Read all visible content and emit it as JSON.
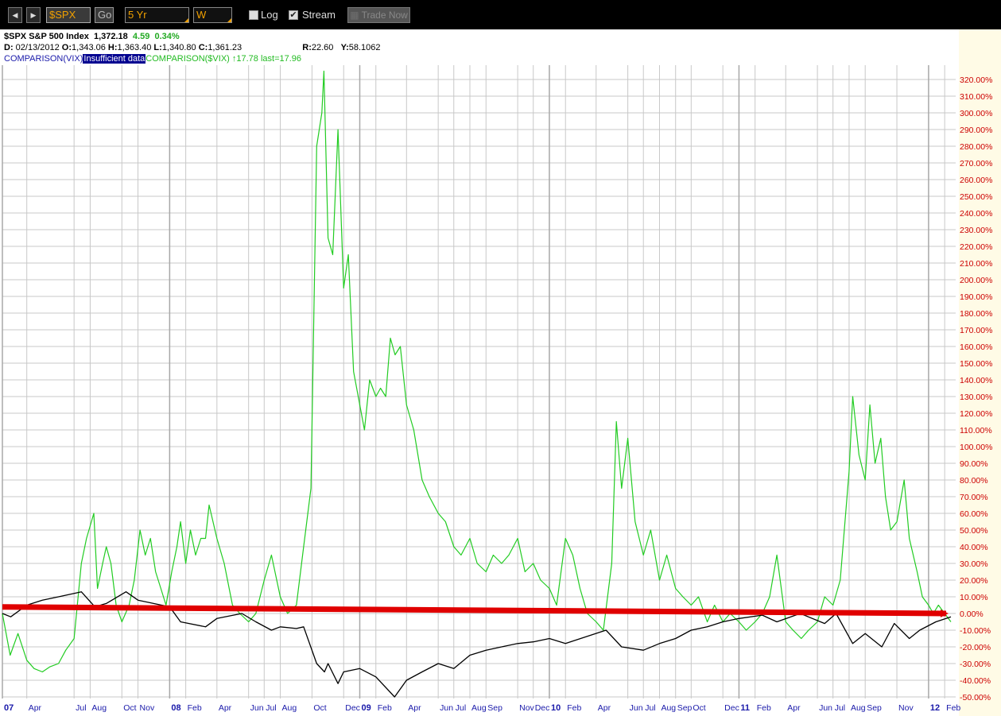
{
  "toolbar": {
    "back_label": "◀",
    "forward_label": "▶",
    "symbol": "$SPX",
    "go_label": "Go",
    "range": "5 Yr",
    "period": "W",
    "log_label": "Log",
    "log_checked": false,
    "stream_label": "Stream",
    "stream_checked": true,
    "trade_label": "Trade Now"
  },
  "header": {
    "symbol": "$SPX",
    "name": "S&P 500 Index",
    "last": "1,372.18",
    "change": "4.59",
    "change_pct": "0.34%",
    "date_label": "D:",
    "date": "02/13/2012",
    "open_label": "O:",
    "open": "1,343.06",
    "high_label": "H:",
    "high": "1,363.40",
    "low_label": "L:",
    "low": "1,340.80",
    "close_label": "C:",
    "close": "1,361.23",
    "r_label": "R:",
    "r": "22.60",
    "y_label": "Y:",
    "y": "58.1062",
    "comparison1": "COMPARISON(VIX)",
    "comparison1_status": "Insufficient data",
    "comparison2": "COMPARISON($VIX) ↑17.78 last=17.96"
  },
  "colors": {
    "vix_line": "#22cc22",
    "spx_line": "#000000",
    "arrow": "#e00000",
    "y_tick_label": "#cc0000",
    "x_month_label": "#1a1aaa",
    "grid": "#c8c8c8"
  },
  "chart_data": {
    "type": "line",
    "ylim": [
      -50,
      330
    ],
    "y_ticks": [
      320,
      310,
      300,
      290,
      280,
      270,
      260,
      250,
      240,
      230,
      220,
      210,
      200,
      190,
      180,
      170,
      160,
      150,
      140,
      130,
      120,
      110,
      100,
      90,
      80,
      70,
      60,
      50,
      40,
      30,
      20,
      10,
      0,
      -10,
      -20,
      -30,
      -40,
      -50
    ],
    "y_tick_labels": [
      "320.00%",
      "310.00%",
      "300.00%",
      "290.00%",
      "280.00%",
      "270.00%",
      "260.00%",
      "250.00%",
      "240.00%",
      "230.00%",
      "220.00%",
      "210.00%",
      "200.00%",
      "190.00%",
      "180.00%",
      "170.00%",
      "160.00%",
      "150.00%",
      "140.00%",
      "130.00%",
      "120.00%",
      "110.00%",
      "100.00%",
      "90.00%",
      "80.00%",
      "70.00%",
      "60.00%",
      "50.00%",
      "40.00%",
      "30.00%",
      "20.00%",
      "10.00%",
      "0.00%",
      "-10.00%",
      "-20.00%",
      "-30.00%",
      "-40.00%",
      "-50.00%"
    ],
    "x_ticks": [
      {
        "date": "2007-02-13",
        "label": "07",
        "major": true
      },
      {
        "date": "2007-04-01",
        "label": "Apr"
      },
      {
        "date": "2007-07-01",
        "label": "Jul"
      },
      {
        "date": "2007-08-01",
        "label": "Aug"
      },
      {
        "date": "2007-10-01",
        "label": "Oct"
      },
      {
        "date": "2007-11-01",
        "label": "Nov"
      },
      {
        "date": "2008-01-01",
        "label": "08",
        "major": true
      },
      {
        "date": "2008-02-01",
        "label": "Feb"
      },
      {
        "date": "2008-04-01",
        "label": "Apr"
      },
      {
        "date": "2008-06-01",
        "label": "Jun"
      },
      {
        "date": "2008-07-01",
        "label": "Jul"
      },
      {
        "date": "2008-08-01",
        "label": "Aug"
      },
      {
        "date": "2008-10-01",
        "label": "Oct"
      },
      {
        "date": "2008-12-01",
        "label": "Dec"
      },
      {
        "date": "2009-01-01",
        "label": "09",
        "major": true
      },
      {
        "date": "2009-02-01",
        "label": "Feb"
      },
      {
        "date": "2009-04-01",
        "label": "Apr"
      },
      {
        "date": "2009-06-01",
        "label": "Jun"
      },
      {
        "date": "2009-07-01",
        "label": "Jul"
      },
      {
        "date": "2009-08-01",
        "label": "Aug"
      },
      {
        "date": "2009-09-01",
        "label": "Sep"
      },
      {
        "date": "2009-11-01",
        "label": "Nov"
      },
      {
        "date": "2009-12-01",
        "label": "Dec"
      },
      {
        "date": "2010-01-01",
        "label": "10",
        "major": true
      },
      {
        "date": "2010-02-01",
        "label": "Feb"
      },
      {
        "date": "2010-04-01",
        "label": "Apr"
      },
      {
        "date": "2010-06-01",
        "label": "Jun"
      },
      {
        "date": "2010-07-01",
        "label": "Jul"
      },
      {
        "date": "2010-08-01",
        "label": "Aug"
      },
      {
        "date": "2010-09-01",
        "label": "Sep"
      },
      {
        "date": "2010-10-01",
        "label": "Oct"
      },
      {
        "date": "2010-12-01",
        "label": "Dec"
      },
      {
        "date": "2011-01-01",
        "label": "11",
        "major": true
      },
      {
        "date": "2011-02-01",
        "label": "Feb"
      },
      {
        "date": "2011-04-01",
        "label": "Apr"
      },
      {
        "date": "2011-06-01",
        "label": "Jun"
      },
      {
        "date": "2011-07-01",
        "label": "Jul"
      },
      {
        "date": "2011-08-01",
        "label": "Aug"
      },
      {
        "date": "2011-09-01",
        "label": "Sep"
      },
      {
        "date": "2011-11-01",
        "label": "Nov"
      },
      {
        "date": "2012-01-01",
        "label": "12",
        "major": true
      },
      {
        "date": "2012-02-01",
        "label": "Feb"
      }
    ],
    "series": [
      {
        "name": "COMPARISON($VIX)",
        "points": [
          [
            "2007-02-13",
            0
          ],
          [
            "2007-02-28",
            -25
          ],
          [
            "2007-03-15",
            -12
          ],
          [
            "2007-04-01",
            -28
          ],
          [
            "2007-04-15",
            -33
          ],
          [
            "2007-05-01",
            -35
          ],
          [
            "2007-05-15",
            -32
          ],
          [
            "2007-06-01",
            -30
          ],
          [
            "2007-06-15",
            -22
          ],
          [
            "2007-07-01",
            -15
          ],
          [
            "2007-07-15",
            30
          ],
          [
            "2007-07-25",
            45
          ],
          [
            "2007-08-08",
            60
          ],
          [
            "2007-08-15",
            15
          ],
          [
            "2007-08-25",
            30
          ],
          [
            "2007-09-01",
            40
          ],
          [
            "2007-09-10",
            30
          ],
          [
            "2007-09-20",
            5
          ],
          [
            "2007-10-01",
            -5
          ],
          [
            "2007-10-15",
            5
          ],
          [
            "2007-10-25",
            20
          ],
          [
            "2007-11-05",
            50
          ],
          [
            "2007-11-15",
            35
          ],
          [
            "2007-11-25",
            45
          ],
          [
            "2007-12-05",
            25
          ],
          [
            "2007-12-15",
            15
          ],
          [
            "2007-12-25",
            5
          ],
          [
            "2008-01-05",
            25
          ],
          [
            "2008-01-15",
            40
          ],
          [
            "2008-01-22",
            55
          ],
          [
            "2008-02-01",
            30
          ],
          [
            "2008-02-10",
            50
          ],
          [
            "2008-02-20",
            35
          ],
          [
            "2008-03-01",
            45
          ],
          [
            "2008-03-10",
            45
          ],
          [
            "2008-03-17",
            65
          ],
          [
            "2008-04-01",
            45
          ],
          [
            "2008-04-15",
            30
          ],
          [
            "2008-05-01",
            5
          ],
          [
            "2008-05-15",
            0
          ],
          [
            "2008-06-01",
            -5
          ],
          [
            "2008-06-15",
            0
          ],
          [
            "2008-07-01",
            20
          ],
          [
            "2008-07-15",
            35
          ],
          [
            "2008-08-01",
            10
          ],
          [
            "2008-08-15",
            0
          ],
          [
            "2008-09-01",
            5
          ],
          [
            "2008-09-15",
            40
          ],
          [
            "2008-09-29",
            75
          ],
          [
            "2008-10-10",
            280
          ],
          [
            "2008-10-20",
            300
          ],
          [
            "2008-10-24",
            325
          ],
          [
            "2008-11-01",
            225
          ],
          [
            "2008-11-10",
            215
          ],
          [
            "2008-11-20",
            290
          ],
          [
            "2008-12-01",
            195
          ],
          [
            "2008-12-10",
            215
          ],
          [
            "2008-12-20",
            145
          ],
          [
            "2009-01-01",
            125
          ],
          [
            "2009-01-10",
            110
          ],
          [
            "2009-01-20",
            140
          ],
          [
            "2009-02-01",
            130
          ],
          [
            "2009-02-10",
            135
          ],
          [
            "2009-02-20",
            130
          ],
          [
            "2009-03-01",
            165
          ],
          [
            "2009-03-10",
            155
          ],
          [
            "2009-03-20",
            160
          ],
          [
            "2009-04-01",
            125
          ],
          [
            "2009-04-15",
            110
          ],
          [
            "2009-05-01",
            80
          ],
          [
            "2009-05-15",
            70
          ],
          [
            "2009-06-01",
            60
          ],
          [
            "2009-06-15",
            55
          ],
          [
            "2009-07-01",
            40
          ],
          [
            "2009-07-15",
            35
          ],
          [
            "2009-08-01",
            45
          ],
          [
            "2009-08-15",
            30
          ],
          [
            "2009-09-01",
            25
          ],
          [
            "2009-09-15",
            35
          ],
          [
            "2009-10-01",
            30
          ],
          [
            "2009-10-15",
            35
          ],
          [
            "2009-11-01",
            45
          ],
          [
            "2009-11-15",
            25
          ],
          [
            "2009-12-01",
            30
          ],
          [
            "2009-12-15",
            20
          ],
          [
            "2010-01-01",
            15
          ],
          [
            "2010-01-15",
            5
          ],
          [
            "2010-02-01",
            45
          ],
          [
            "2010-02-15",
            35
          ],
          [
            "2010-03-01",
            15
          ],
          [
            "2010-03-15",
            0
          ],
          [
            "2010-04-01",
            -5
          ],
          [
            "2010-04-15",
            -10
          ],
          [
            "2010-05-01",
            30
          ],
          [
            "2010-05-10",
            115
          ],
          [
            "2010-05-20",
            75
          ],
          [
            "2010-06-01",
            105
          ],
          [
            "2010-06-15",
            55
          ],
          [
            "2010-07-01",
            35
          ],
          [
            "2010-07-15",
            50
          ],
          [
            "2010-08-01",
            20
          ],
          [
            "2010-08-15",
            35
          ],
          [
            "2010-09-01",
            15
          ],
          [
            "2010-09-15",
            10
          ],
          [
            "2010-10-01",
            5
          ],
          [
            "2010-10-15",
            10
          ],
          [
            "2010-11-01",
            -5
          ],
          [
            "2010-11-15",
            5
          ],
          [
            "2010-12-01",
            -5
          ],
          [
            "2010-12-15",
            0
          ],
          [
            "2011-01-01",
            -5
          ],
          [
            "2011-01-15",
            -10
          ],
          [
            "2011-02-01",
            -5
          ],
          [
            "2011-02-15",
            0
          ],
          [
            "2011-03-01",
            10
          ],
          [
            "2011-03-15",
            35
          ],
          [
            "2011-04-01",
            -5
          ],
          [
            "2011-04-15",
            -10
          ],
          [
            "2011-05-01",
            -15
          ],
          [
            "2011-05-15",
            -10
          ],
          [
            "2011-06-01",
            -5
          ],
          [
            "2011-06-15",
            10
          ],
          [
            "2011-07-01",
            5
          ],
          [
            "2011-07-15",
            20
          ],
          [
            "2011-08-01",
            85
          ],
          [
            "2011-08-08",
            130
          ],
          [
            "2011-08-20",
            95
          ],
          [
            "2011-09-01",
            80
          ],
          [
            "2011-09-10",
            125
          ],
          [
            "2011-09-20",
            90
          ],
          [
            "2011-10-01",
            105
          ],
          [
            "2011-10-10",
            70
          ],
          [
            "2011-10-20",
            50
          ],
          [
            "2011-11-01",
            55
          ],
          [
            "2011-11-15",
            80
          ],
          [
            "2011-11-25",
            45
          ],
          [
            "2011-12-10",
            25
          ],
          [
            "2011-12-20",
            10
          ],
          [
            "2012-01-01",
            5
          ],
          [
            "2012-01-10",
            0
          ],
          [
            "2012-01-20",
            5
          ],
          [
            "2012-02-01",
            0
          ],
          [
            "2012-02-13",
            -5
          ]
        ]
      },
      {
        "name": "$SPX",
        "points": [
          [
            "2007-02-13",
            0
          ],
          [
            "2007-03-01",
            -2
          ],
          [
            "2007-04-01",
            5
          ],
          [
            "2007-05-01",
            8
          ],
          [
            "2007-06-01",
            10
          ],
          [
            "2007-07-01",
            12
          ],
          [
            "2007-07-15",
            13
          ],
          [
            "2007-08-10",
            4
          ],
          [
            "2007-09-01",
            6
          ],
          [
            "2007-10-09",
            13
          ],
          [
            "2007-11-01",
            8
          ],
          [
            "2007-12-01",
            6
          ],
          [
            "2008-01-01",
            4
          ],
          [
            "2008-01-22",
            -5
          ],
          [
            "2008-03-10",
            -8
          ],
          [
            "2008-04-01",
            -3
          ],
          [
            "2008-05-19",
            0
          ],
          [
            "2008-06-15",
            -5
          ],
          [
            "2008-07-15",
            -10
          ],
          [
            "2008-08-01",
            -8
          ],
          [
            "2008-09-01",
            -9
          ],
          [
            "2008-09-15",
            -8
          ],
          [
            "2008-10-10",
            -30
          ],
          [
            "2008-10-25",
            -35
          ],
          [
            "2008-11-01",
            -30
          ],
          [
            "2008-11-20",
            -42
          ],
          [
            "2008-12-01",
            -35
          ],
          [
            "2009-01-01",
            -33
          ],
          [
            "2009-02-01",
            -38
          ],
          [
            "2009-03-09",
            -50
          ],
          [
            "2009-04-01",
            -40
          ],
          [
            "2009-05-01",
            -35
          ],
          [
            "2009-06-01",
            -30
          ],
          [
            "2009-07-01",
            -33
          ],
          [
            "2009-08-01",
            -25
          ],
          [
            "2009-09-01",
            -22
          ],
          [
            "2009-10-01",
            -20
          ],
          [
            "2009-11-01",
            -18
          ],
          [
            "2009-12-01",
            -17
          ],
          [
            "2010-01-01",
            -15
          ],
          [
            "2010-02-01",
            -18
          ],
          [
            "2010-04-20",
            -10
          ],
          [
            "2010-05-20",
            -20
          ],
          [
            "2010-07-01",
            -22
          ],
          [
            "2010-08-01",
            -18
          ],
          [
            "2010-09-01",
            -15
          ],
          [
            "2010-10-01",
            -10
          ],
          [
            "2010-11-01",
            -8
          ],
          [
            "2010-12-01",
            -5
          ],
          [
            "2011-01-01",
            -3
          ],
          [
            "2011-02-15",
            -1
          ],
          [
            "2011-03-15",
            -5
          ],
          [
            "2011-04-29",
            0
          ],
          [
            "2011-06-15",
            -6
          ],
          [
            "2011-07-07",
            0
          ],
          [
            "2011-08-08",
            -18
          ],
          [
            "2011-09-01",
            -12
          ],
          [
            "2011-10-03",
            -20
          ],
          [
            "2011-10-27",
            -6
          ],
          [
            "2011-11-25",
            -15
          ],
          [
            "2011-12-15",
            -10
          ],
          [
            "2012-01-15",
            -5
          ],
          [
            "2012-02-13",
            -2
          ]
        ]
      }
    ],
    "annotation": {
      "type": "arrow",
      "from": [
        "2007-02-13",
        2
      ],
      "to": [
        "2012-02-13",
        0
      ]
    }
  }
}
